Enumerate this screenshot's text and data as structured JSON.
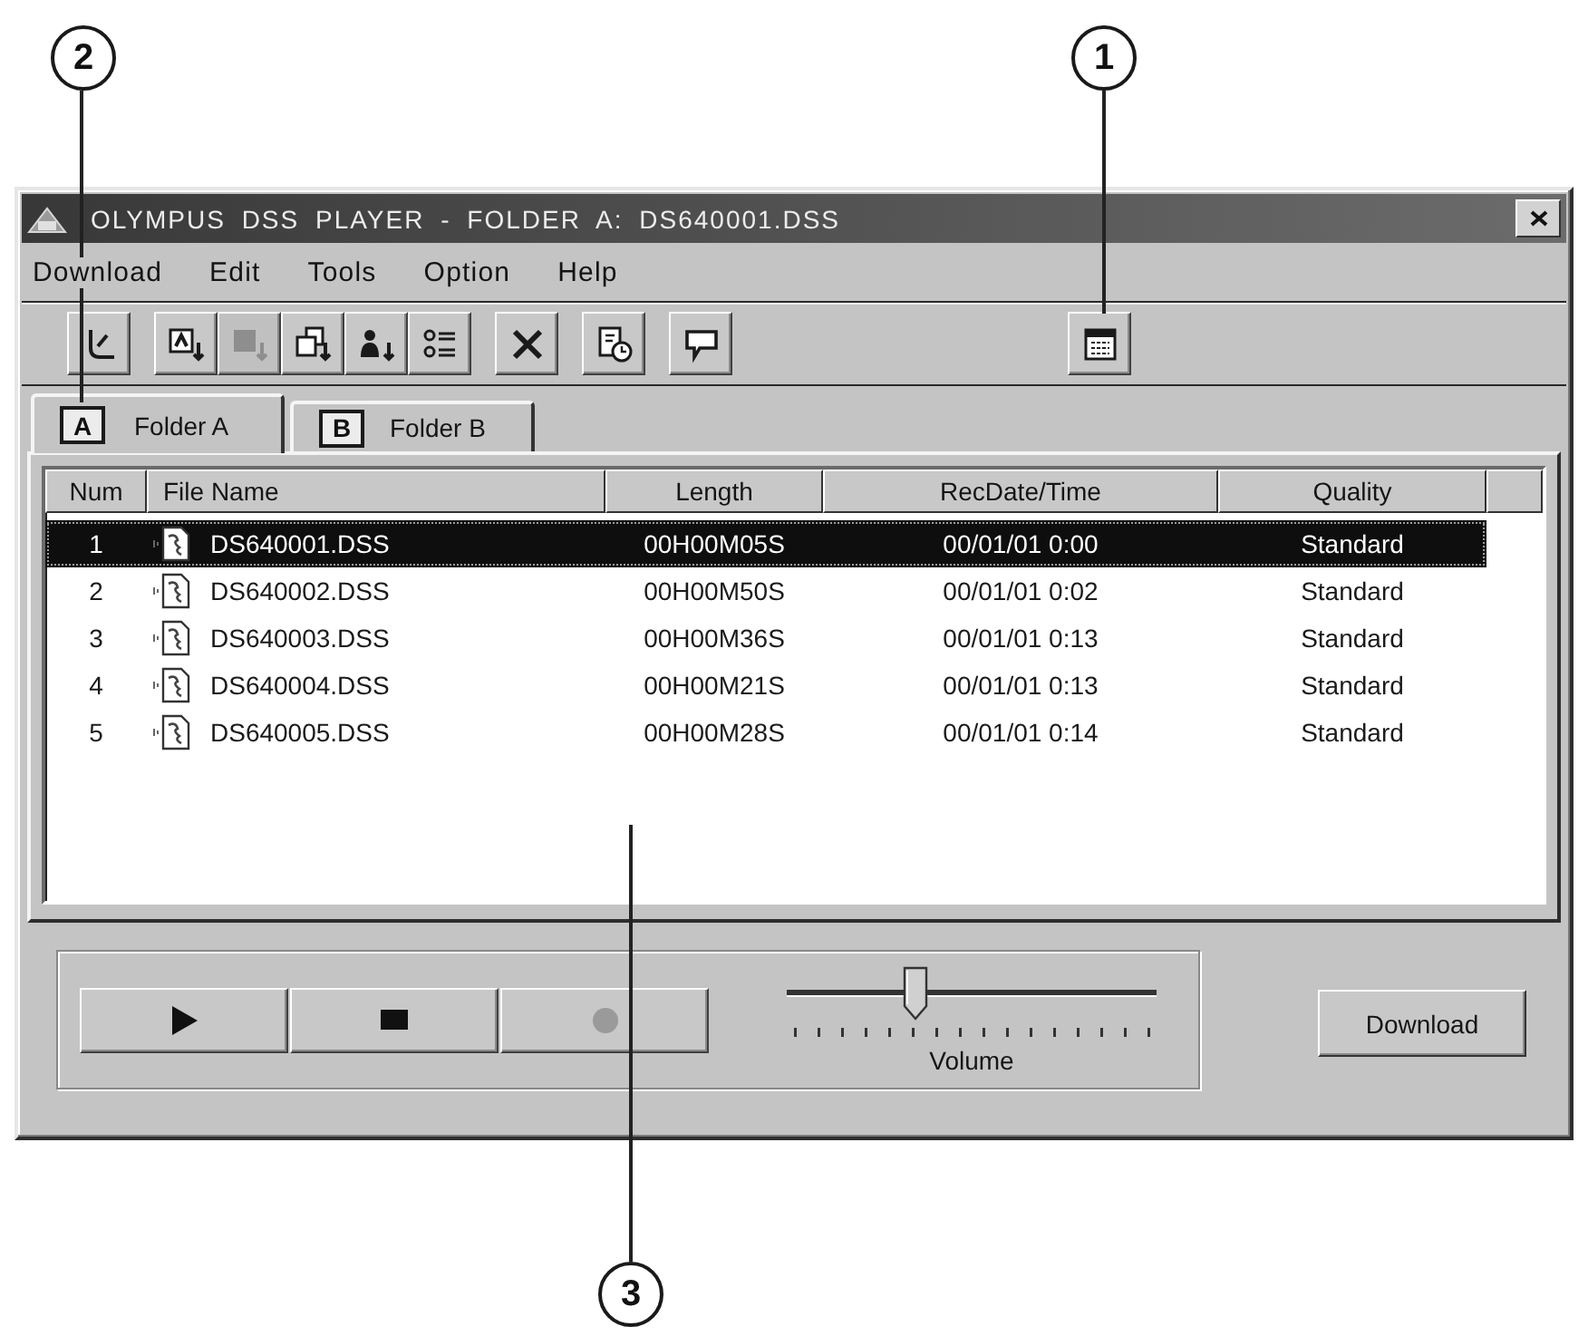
{
  "callouts": [
    {
      "number": "2"
    },
    {
      "number": "1"
    },
    {
      "number": "3"
    }
  ],
  "window": {
    "title": "OLYMPUS DSS PLAYER - FOLDER A: DS640001.DSS"
  },
  "menu": [
    "Download",
    "Edit",
    "Tools",
    "Option",
    "Help"
  ],
  "toolbar": [
    [
      {
        "kind": "hook",
        "disabled": false
      }
    ],
    [
      {
        "kind": "box-down",
        "disabled": false
      },
      {
        "kind": "square-down",
        "disabled": true
      },
      {
        "kind": "boxes-down",
        "disabled": false
      },
      {
        "kind": "figure-down",
        "disabled": false
      },
      {
        "kind": "list",
        "disabled": false
      }
    ],
    [
      {
        "kind": "delete",
        "disabled": false
      }
    ],
    [
      {
        "kind": "document-clock",
        "disabled": false
      }
    ],
    [
      {
        "kind": "speech-bubble",
        "disabled": false
      }
    ],
    [
      {
        "kind": "window",
        "disabled": false
      }
    ]
  ],
  "tabs": [
    {
      "letter": "A",
      "label": "Folder A",
      "selected": true
    },
    {
      "letter": "B",
      "label": "Folder B",
      "selected": false
    }
  ],
  "table": {
    "columns": [
      "Num",
      "File Name",
      "Length",
      "RecDate/Time",
      "Quality"
    ],
    "rows": [
      {
        "num": "1",
        "file_name": "DS640001.DSS",
        "length": "00H00M05S",
        "rec_date_time": "00/01/01 0:00",
        "quality": "Standard",
        "selected": true
      },
      {
        "num": "2",
        "file_name": "DS640002.DSS",
        "length": "00H00M50S",
        "rec_date_time": "00/01/01 0:02",
        "quality": "Standard",
        "selected": false
      },
      {
        "num": "3",
        "file_name": "DS640003.DSS",
        "length": "00H00M36S",
        "rec_date_time": "00/01/01 0:13",
        "quality": "Standard",
        "selected": false
      },
      {
        "num": "4",
        "file_name": "DS640004.DSS",
        "length": "00H00M21S",
        "rec_date_time": "00/01/01 0:13",
        "quality": "Standard",
        "selected": false
      },
      {
        "num": "5",
        "file_name": "DS640005.DSS",
        "length": "00H00M28S",
        "rec_date_time": "00/01/01 0:14",
        "quality": "Standard",
        "selected": false
      }
    ]
  },
  "player": {
    "buttons": [
      {
        "kind": "play",
        "disabled": false
      },
      {
        "kind": "stop",
        "disabled": false
      },
      {
        "kind": "record",
        "disabled": true
      }
    ],
    "volume": {
      "label": "Volume",
      "level": 0.35
    },
    "download_button": "Download"
  }
}
